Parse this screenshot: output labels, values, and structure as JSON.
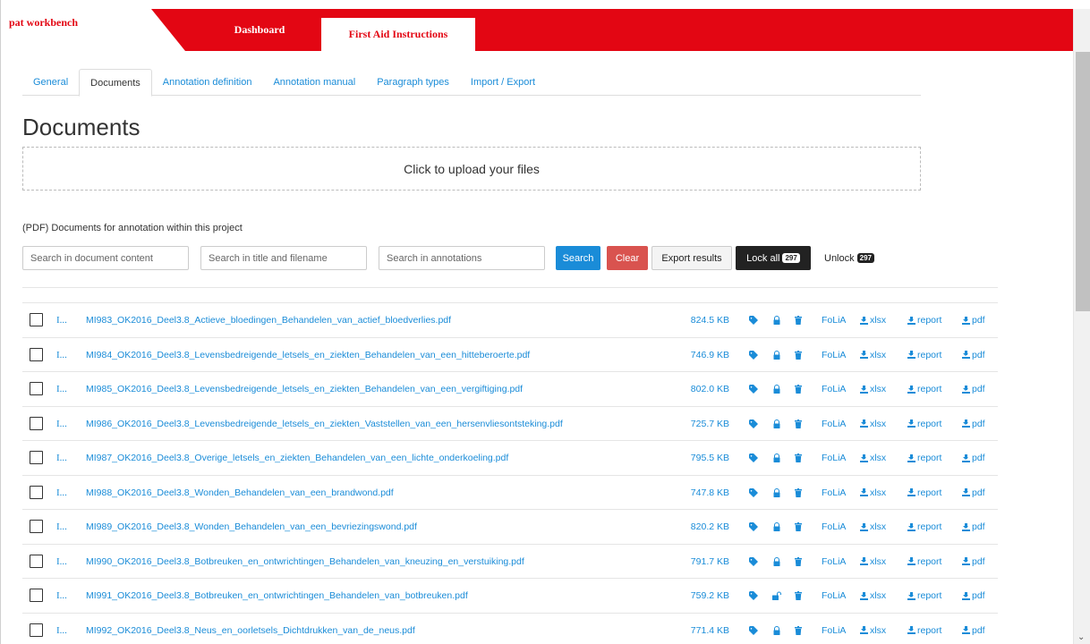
{
  "app": {
    "brand": "pat workbench"
  },
  "topnav": {
    "dashboard": "Dashboard",
    "active": "First Aid Instructions"
  },
  "tabs": [
    {
      "label": "General",
      "active": false
    },
    {
      "label": "Documents",
      "active": true
    },
    {
      "label": "Annotation definition",
      "active": false
    },
    {
      "label": "Annotation manual",
      "active": false
    },
    {
      "label": "Paragraph types",
      "active": false
    },
    {
      "label": "Import / Export",
      "active": false
    }
  ],
  "page": {
    "title": "Documents",
    "upload_text": "Click to upload your files",
    "section_label": "(PDF) Documents for annotation within this project"
  },
  "search": {
    "content_placeholder": "Search in document content",
    "title_placeholder": "Search in title and filename",
    "annotations_placeholder": "Search in annotations",
    "search_label": "Search",
    "clear_label": "Clear",
    "export_label": "Export results",
    "lock_all_label": "Lock all",
    "lock_all_count": "297",
    "unlock_label": "Unlock",
    "unlock_count": "297"
  },
  "row_links": {
    "folia": "FoLiA",
    "xlsx": "xlsx",
    "report": "report",
    "pdf": "pdf",
    "cursor": "I..."
  },
  "colors": {
    "brand_red": "#e30613",
    "link_blue": "#1a8cd8",
    "clear_red": "#d9534f",
    "dark": "#222222"
  },
  "documents": [
    {
      "name": "MI983_OK2016_Deel3.8_Actieve_bloedingen_Behandelen_van_actief_bloedverlies.pdf",
      "size": "824.5 KB",
      "locked": true
    },
    {
      "name": "MI984_OK2016_Deel3.8_Levensbedreigende_letsels_en_ziekten_Behandelen_van_een_hitteberoerte.pdf",
      "size": "746.9 KB",
      "locked": true
    },
    {
      "name": "MI985_OK2016_Deel3.8_Levensbedreigende_letsels_en_ziekten_Behandelen_van_een_vergiftiging.pdf",
      "size": "802.0 KB",
      "locked": true
    },
    {
      "name": "MI986_OK2016_Deel3.8_Levensbedreigende_letsels_en_ziekten_Vaststellen_van_een_hersenvliesontsteking.pdf",
      "size": "725.7 KB",
      "locked": true
    },
    {
      "name": "MI987_OK2016_Deel3.8_Overige_letsels_en_ziekten_Behandelen_van_een_lichte_onderkoeling.pdf",
      "size": "795.5 KB",
      "locked": true
    },
    {
      "name": "MI988_OK2016_Deel3.8_Wonden_Behandelen_van_een_brandwond.pdf",
      "size": "747.8 KB",
      "locked": true
    },
    {
      "name": "MI989_OK2016_Deel3.8_Wonden_Behandelen_van_een_bevriezingswond.pdf",
      "size": "820.2 KB",
      "locked": true
    },
    {
      "name": "MI990_OK2016_Deel3.8_Botbreuken_en_ontwrichtingen_Behandelen_van_kneuzing_en_verstuiking.pdf",
      "size": "791.7 KB",
      "locked": true
    },
    {
      "name": "MI991_OK2016_Deel3.8_Botbreuken_en_ontwrichtingen_Behandelen_van_botbreuken.pdf",
      "size": "759.2 KB",
      "locked": false
    },
    {
      "name": "MI992_OK2016_Deel3.8_Neus_en_oorletsels_Dichtdrukken_van_de_neus.pdf",
      "size": "771.4 KB",
      "locked": true
    }
  ]
}
